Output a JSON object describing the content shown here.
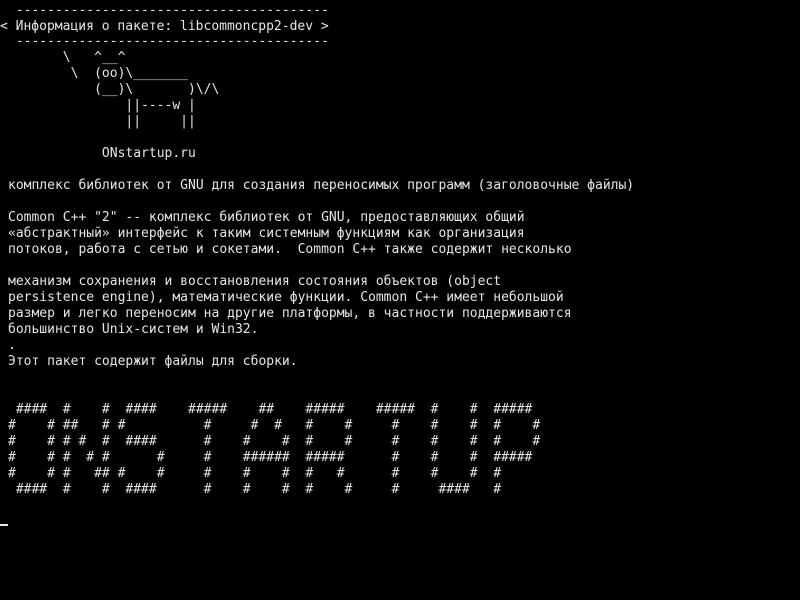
{
  "terminal": {
    "bubble": {
      "top_border": " ----------------------------------------",
      "text": "< Информация о пакете: libcommoncpp2-dev >",
      "bottom_border": " ----------------------------------------"
    },
    "cow": [
      "       \\   ^__^",
      "        \\  (oo)\\_______",
      "           (__)\\       )\\/\\",
      "               ||----w |",
      "               ||     ||"
    ],
    "signature": "            ONstartup.ru",
    "description": {
      "summary": "комплекс библиотек от GNU для создания переносимых программ (заголовочные файлы)",
      "paragraph1": [
        "Common C++ \"2\" -- комплекс библиотек от GNU, предоставляющих общий",
        "«абстрактный» интерфейс к таким системным функциям как организация",
        "потоков, работа с сетью и сокетами.  Common C++ также содержит несколько"
      ],
      "paragraph2": [
        "механизм сохранения и восстановления состояния объектов (object",
        "persistence engine), математические функции. Common C++ имеет небольшой",
        "размер и легко переносим на другие платформы, в частности поддерживаются",
        "большинство Unix-систем и Win32.",
        ".",
        "Этот пакет содержит файлы для сборки."
      ]
    },
    "banner": [
      " ####  #    #  ####    #####    ##    #####    #####  #    #  #####",
      "#    # ##   # #          #     #  #   #    #     #    #    #  #    #",
      "#    # # #  #  ####      #    #    #  #    #     #    #    #  #    #",
      "#    # #  # #      #     #    ######  #####      #    #    #  #####",
      "#    # #   ## #    #     #    #    #  #   #      #    #    #  #",
      " ####  #    #  ####      #    #    #  #    #     #     ####   #"
    ]
  }
}
